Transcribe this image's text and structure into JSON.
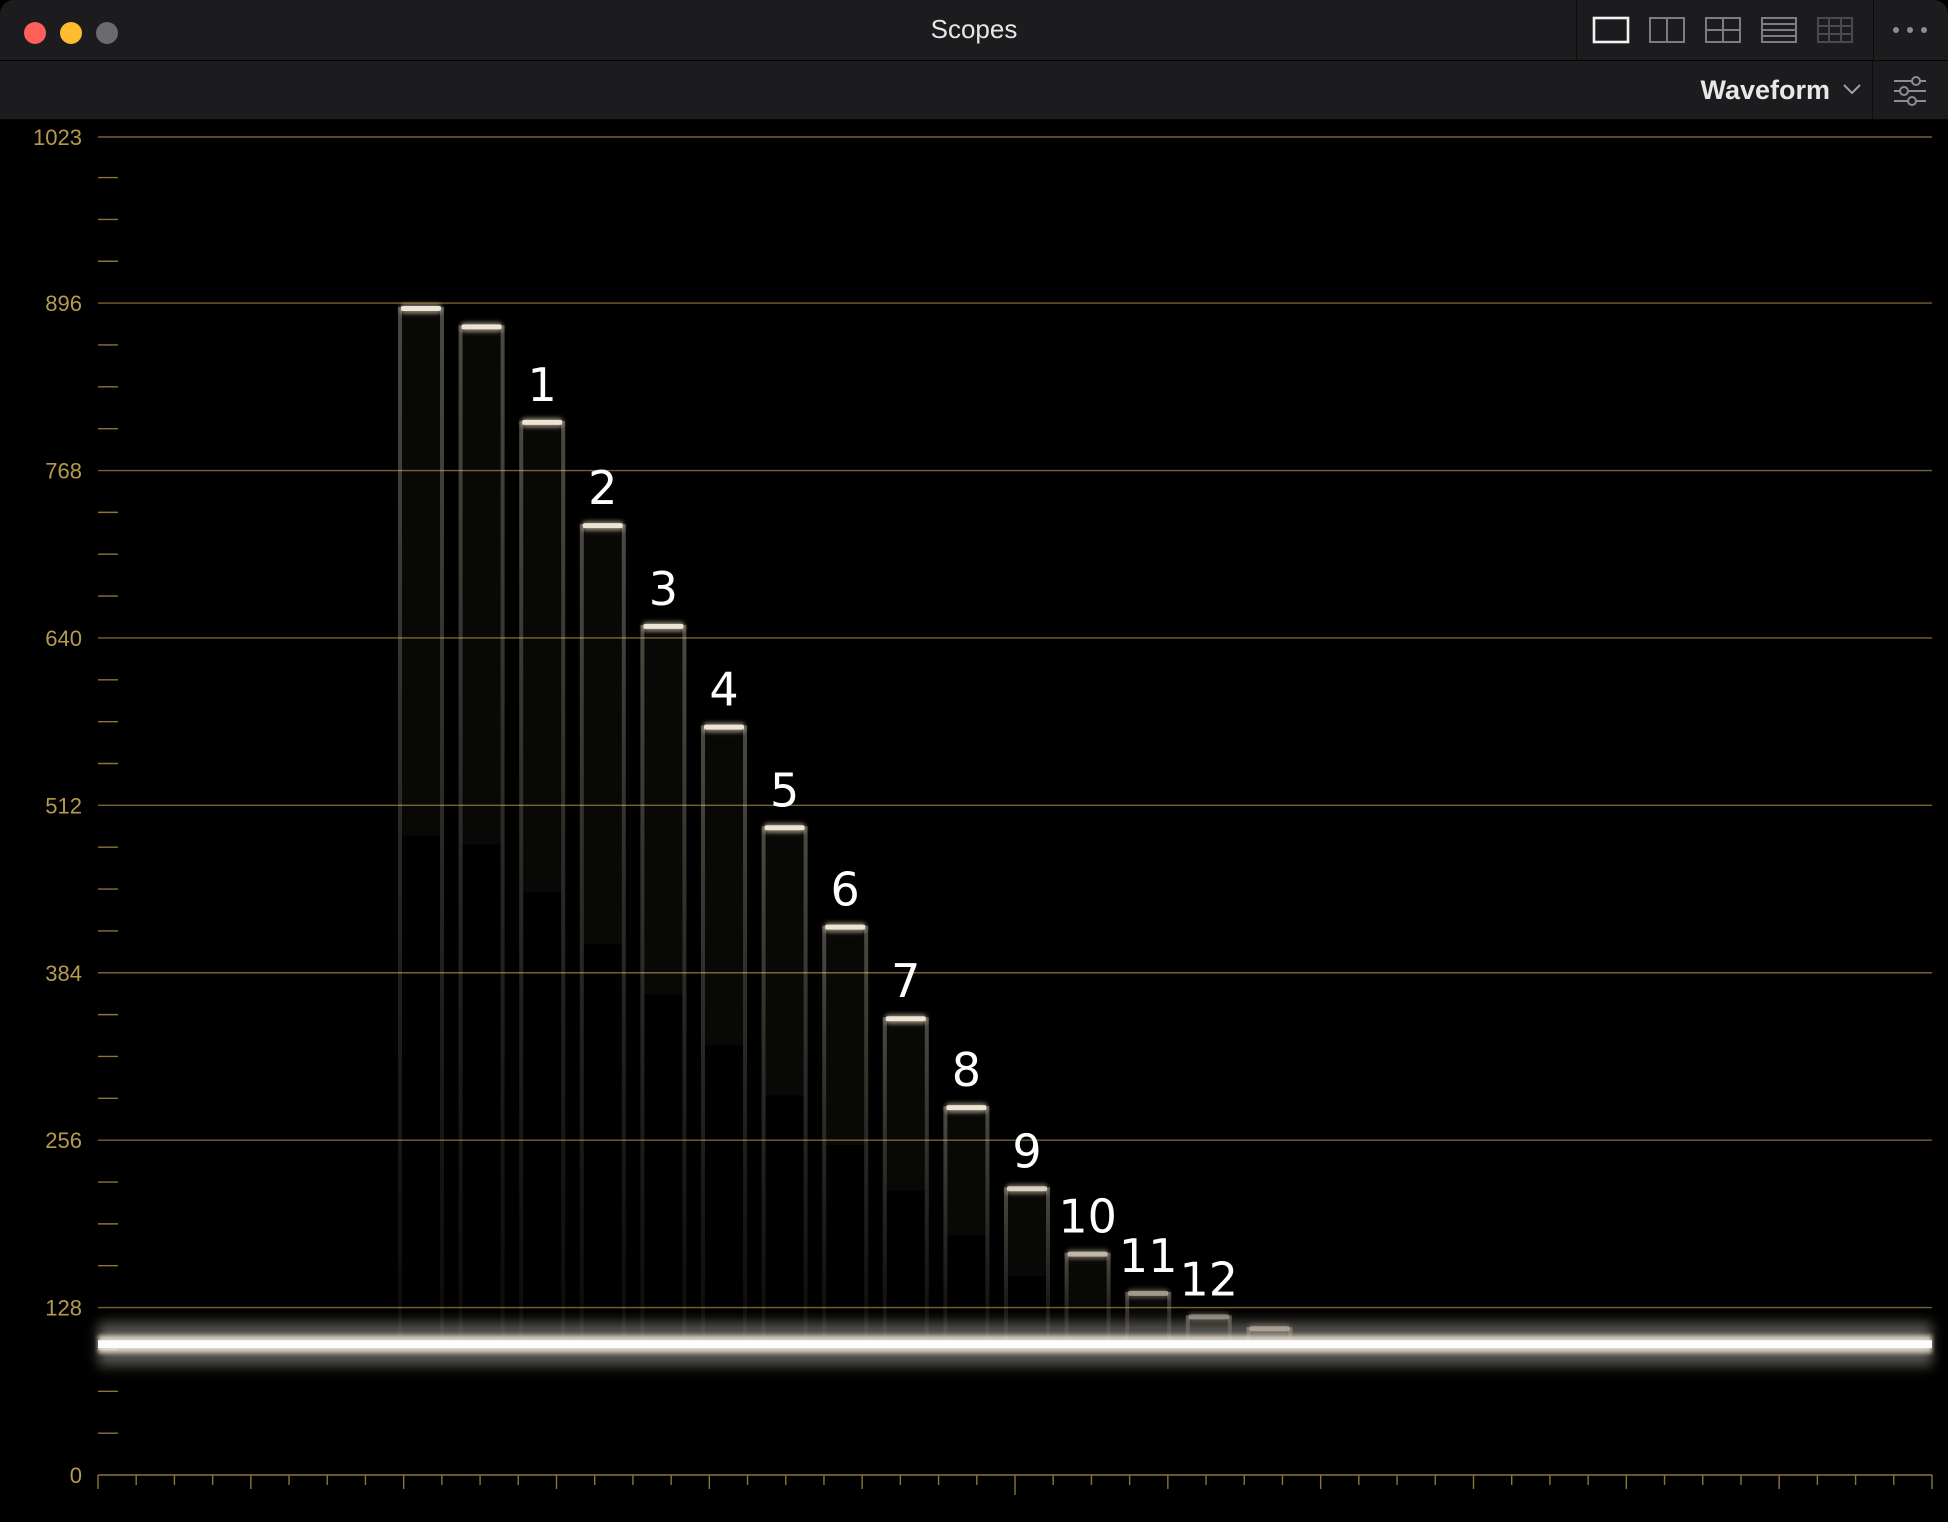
{
  "window": {
    "title": "Scopes"
  },
  "titlebar": {
    "layout_icons": [
      "single-view-icon",
      "two-up-view-icon",
      "quad-view-icon",
      "stacked-view-icon",
      "grid-view-icon"
    ],
    "more_icon": "more-options-icon"
  },
  "toolbar": {
    "mode": "Waveform",
    "mode_icon": "chevron-down-icon",
    "settings_icon": "sliders-icon"
  },
  "colors": {
    "grid": "#8a7438",
    "axis_text": "#b59a4e",
    "trace": "#f2eadb",
    "label": "#ffffff"
  },
  "chart_data": {
    "type": "waveform",
    "y_axis_ticks": [
      "1023",
      "896",
      "768",
      "640",
      "512",
      "384",
      "256",
      "128",
      "0"
    ],
    "ylim": [
      0,
      1023
    ],
    "grid": true,
    "baseline_level": 100,
    "steps": [
      {
        "label": "",
        "level": 893
      },
      {
        "label": "",
        "level": 879
      },
      {
        "label": "1",
        "level": 806
      },
      {
        "label": "2",
        "level": 727
      },
      {
        "label": "3",
        "level": 650
      },
      {
        "label": "4",
        "level": 573
      },
      {
        "label": "5",
        "level": 496
      },
      {
        "label": "6",
        "level": 420
      },
      {
        "label": "7",
        "level": 350
      },
      {
        "label": "8",
        "level": 282
      },
      {
        "label": "9",
        "level": 220
      },
      {
        "label": "10",
        "level": 170
      },
      {
        "label": "11",
        "level": 140
      },
      {
        "label": "12",
        "level": 122
      },
      {
        "label": "",
        "level": 113
      }
    ]
  }
}
